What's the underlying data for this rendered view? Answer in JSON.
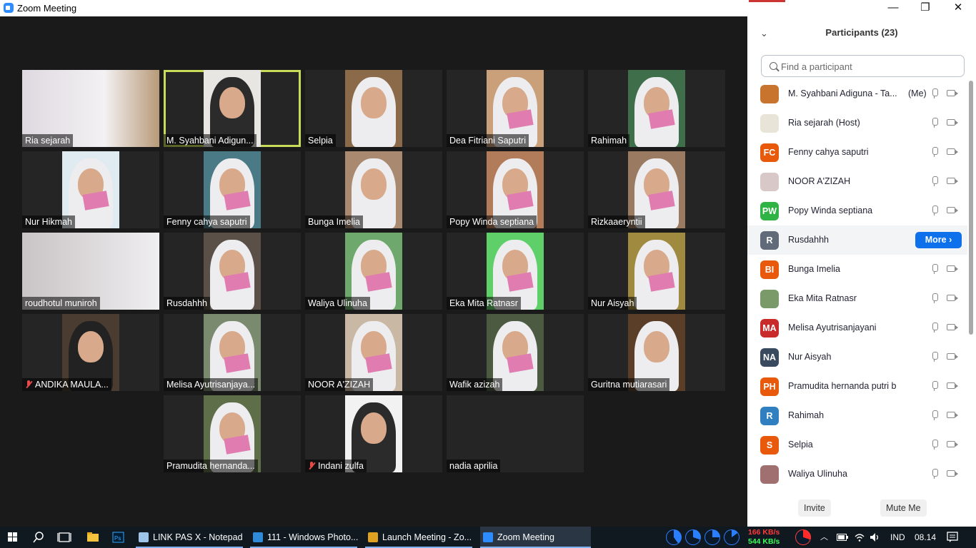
{
  "window": {
    "title": "Zoom Meeting",
    "minimize": "—",
    "restore": "❐",
    "close": "✕"
  },
  "gallery": [
    {
      "name": "Ria sejarah",
      "muted": false
    },
    {
      "name": "M. Syahbani Adigun...",
      "muted": false
    },
    {
      "name": "Selpia",
      "muted": false
    },
    {
      "name": "Dea Fitriani Saputri",
      "muted": false
    },
    {
      "name": "Rahimah",
      "muted": false
    },
    {
      "name": "Nur Hikmah",
      "muted": false
    },
    {
      "name": "Fenny cahya saputri",
      "muted": false
    },
    {
      "name": "Bunga Imelia",
      "muted": false
    },
    {
      "name": "Popy Winda septiana",
      "muted": false
    },
    {
      "name": "Rizkaaeryntii",
      "muted": false
    },
    {
      "name": "roudhotul muniroh",
      "muted": false
    },
    {
      "name": "Rusdahhh",
      "muted": false
    },
    {
      "name": "Waliya Ulinuha",
      "muted": false
    },
    {
      "name": "Eka Mita Ratnasr",
      "muted": false
    },
    {
      "name": "Nur Aisyah",
      "muted": false
    },
    {
      "name": "ANDIKA MAULA...",
      "muted": true
    },
    {
      "name": "Melisa Ayutrisanjaya...",
      "muted": false
    },
    {
      "name": "NOOR A'ZIZAH",
      "muted": false
    },
    {
      "name": "Wafik azizah",
      "muted": false
    },
    {
      "name": "Guritna mutiarasari",
      "muted": false
    },
    {
      "name": "Pramudita hernanda...",
      "muted": false
    },
    {
      "name": "Indani zulfa",
      "muted": true
    },
    {
      "name": "nadia aprilia",
      "muted": false
    }
  ],
  "panel": {
    "title": "Participants (23)",
    "collapse_icon": "⌄",
    "search_placeholder": "Find a participant",
    "participants": [
      {
        "name": "M. Syahbani Adiguna - Ta...",
        "tag": "(Me)",
        "initials": "",
        "color": "#c8742e"
      },
      {
        "name": "Ria sejarah (Host)",
        "tag": "",
        "initials": "",
        "color": "#e9e4d8"
      },
      {
        "name": "Fenny cahya saputri",
        "tag": "",
        "initials": "FC",
        "color": "#e8590c"
      },
      {
        "name": "NOOR A'ZIZAH",
        "tag": "",
        "initials": "",
        "color": "#d9c8c8"
      },
      {
        "name": "Popy Winda septiana",
        "tag": "",
        "initials": "PW",
        "color": "#2fb344"
      },
      {
        "name": "Rusdahhh",
        "tag": "",
        "initials": "R",
        "color": "#606a78",
        "more": "More"
      },
      {
        "name": "Bunga Imelia",
        "tag": "",
        "initials": "BI",
        "color": "#e8590c"
      },
      {
        "name": "Eka Mita Ratnasr",
        "tag": "",
        "initials": "",
        "color": "#7a9a6a"
      },
      {
        "name": "Melisa Ayutrisanjayani",
        "tag": "",
        "initials": "MA",
        "color": "#c92a2a"
      },
      {
        "name": "Nur Aisyah",
        "tag": "",
        "initials": "NA",
        "color": "#394a5e"
      },
      {
        "name": "Pramudita hernanda putri b",
        "tag": "",
        "initials": "PH",
        "color": "#e8590c"
      },
      {
        "name": "Rahimah",
        "tag": "",
        "initials": "R",
        "color": "#2f7fc1"
      },
      {
        "name": "Selpia",
        "tag": "",
        "initials": "S",
        "color": "#e8590c"
      },
      {
        "name": "Waliya Ulinuha",
        "tag": "",
        "initials": "",
        "color": "#a07070"
      }
    ],
    "invite_label": "Invite",
    "mute_me_label": "Mute Me"
  },
  "taskbar": {
    "apps": [
      {
        "label": "LINK PAS X - Notepad",
        "color": "#9ec5e8"
      },
      {
        "label": "111 - Windows Photo...",
        "color": "#2f8ad8"
      },
      {
        "label": "Launch Meeting - Zo...",
        "color": "#e0a020"
      },
      {
        "label": "Zoom Meeting",
        "color": "#2d8cff"
      }
    ],
    "net_up": "166 KB/s",
    "net_down": "544 KB/s",
    "language": "IND",
    "time": "08.14"
  }
}
